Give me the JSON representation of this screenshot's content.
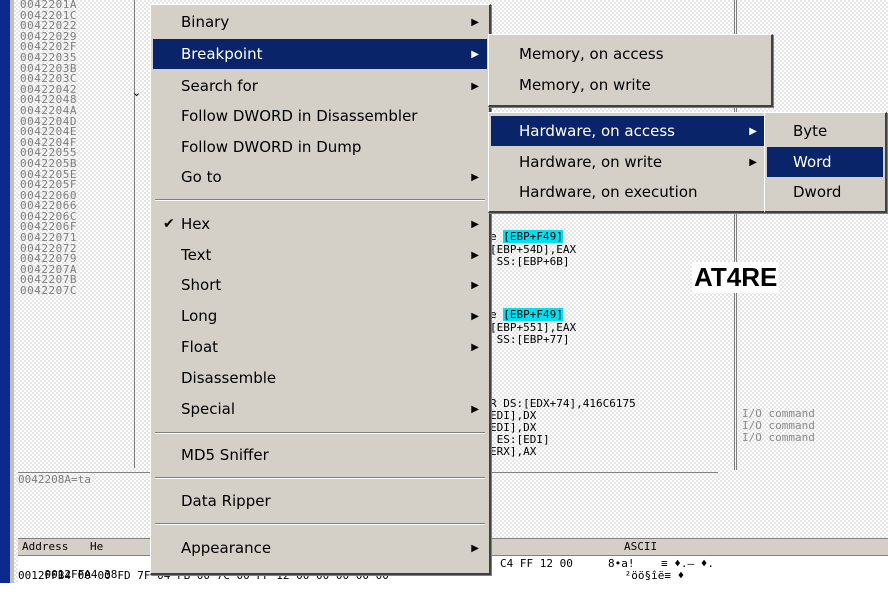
{
  "disasm": {
    "addresses": [
      "0042201A",
      "0042201C",
      "00422022",
      "00422029",
      "0042202F",
      "00422035",
      "0042203B",
      "0042203C",
      "00422042",
      "00422048",
      "0042204A",
      "0042204D",
      "0042204E",
      "0042204F",
      "00422055",
      "0042205B",
      "0042205E",
      "0042205F",
      "00422060",
      "00422066",
      "0042206C",
      "0042206F",
      "00422071",
      "00422072",
      "00422079",
      "0042207A",
      "0042207B",
      "0042207C"
    ],
    "status": "0042208A=ta",
    "code_lines": [
      {
        "text": "[EBP+F49]",
        "prefix": "e ",
        "highlight": true
      },
      {
        "text": "[EBP+54D],EAX",
        "prefix": "",
        "highlight": false
      },
      {
        "text": "SS:[EBP+6B]",
        "prefix": " ",
        "highlight": false
      },
      {
        "text": "[EBP+F49]",
        "prefix": "e ",
        "highlight": true
      },
      {
        "text": "[EBP+551],EAX",
        "prefix": "",
        "highlight": false
      },
      {
        "text": "SS:[EBP+77]",
        "prefix": " ",
        "highlight": false
      },
      {
        "text": "R DS:[EDX+74],416C6175",
        "prefix": "",
        "highlight": false
      },
      {
        "text": "EDI],DX",
        "prefix": "",
        "highlight": false
      },
      {
        "text": "EDI],DX",
        "prefix": "",
        "highlight": false
      },
      {
        "text": "ES:[EDI]",
        "prefix": " ",
        "highlight": false
      },
      {
        "text": "ERX],AX",
        "prefix": "",
        "highlight": false
      }
    ],
    "comments": [
      "I/O command",
      "I/O command",
      "I/O command"
    ],
    "watermark": "AT4RE"
  },
  "dump": {
    "col_address": "Address",
    "col_hex": "He",
    "col_ascii": "ASCII",
    "row1": "0012FFA4 38",
    "row1_hex": "C4 FF 12 00",
    "row1_ascii": "8•a!    ≡ ♦.— ♦.",
    "row2": "0012FFB4 00 00 FD 7F 04 FB 00 7C 00 FF 12 00 00 00 00 00",
    "row2_ascii": " ²öö§îë≡ ♦"
  },
  "context_menu": {
    "items": [
      {
        "label": "Binary",
        "submenu": true
      },
      {
        "label": "Breakpoint",
        "submenu": true,
        "selected": true
      },
      {
        "label": "Search for",
        "submenu": true
      },
      {
        "label": "Follow DWORD in Disassembler",
        "submenu": false
      },
      {
        "label": "Follow DWORD in Dump",
        "submenu": false
      },
      {
        "label": "Go to",
        "submenu": true
      },
      {
        "label": "Hex",
        "submenu": true,
        "checked": true
      },
      {
        "label": "Text",
        "submenu": true
      },
      {
        "label": "Short",
        "submenu": true
      },
      {
        "label": "Long",
        "submenu": true
      },
      {
        "label": "Float",
        "submenu": true
      },
      {
        "label": "Disassemble",
        "submenu": false
      },
      {
        "label": "Special",
        "submenu": true
      },
      {
        "label": "MD5 Sniffer",
        "submenu": false
      },
      {
        "label": "Data Ripper",
        "submenu": false
      },
      {
        "label": "Appearance",
        "submenu": true
      }
    ],
    "check_glyph": "✔",
    "arrow_glyph": "▶"
  },
  "breakpoint_menu": {
    "items": [
      {
        "label": "Memory, on access"
      },
      {
        "label": "Memory, on write"
      }
    ]
  },
  "hardware_menu": {
    "items": [
      {
        "label": "Hardware, on access",
        "submenu": true,
        "selected": true
      },
      {
        "label": "Hardware, on write",
        "submenu": true
      },
      {
        "label": "Hardware, on execution",
        "submenu": false
      }
    ]
  },
  "size_menu": {
    "items": [
      {
        "label": "Byte"
      },
      {
        "label": "Word",
        "selected": true
      },
      {
        "label": "Dword"
      }
    ]
  }
}
